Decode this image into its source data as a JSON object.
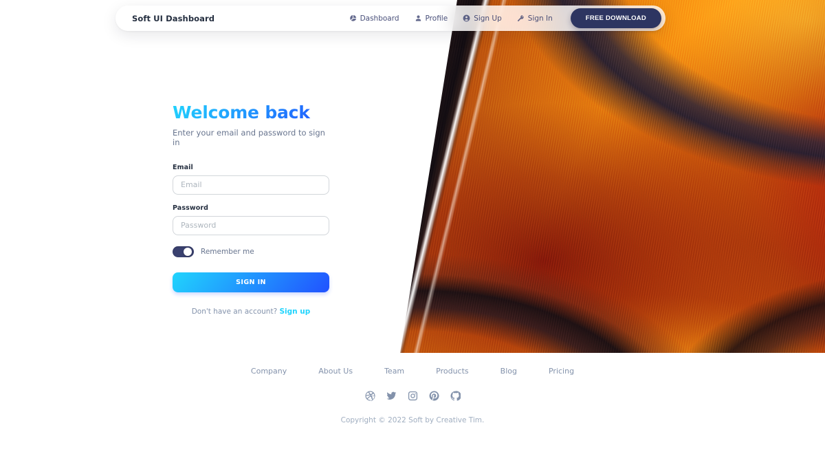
{
  "navbar": {
    "brand": "Soft UI Dashboard",
    "links": [
      {
        "label": "Dashboard",
        "icon": "chart-pie-icon"
      },
      {
        "label": "Profile",
        "icon": "person-icon"
      },
      {
        "label": "Sign Up",
        "icon": "user-circle-icon"
      },
      {
        "label": "Sign In",
        "icon": "key-icon"
      }
    ],
    "cta_label": "FREE DOWNLOAD",
    "cta_color": "#2d3561"
  },
  "form": {
    "heading": "Welcome back",
    "subtitle": "Enter your email and password to sign in",
    "email_label": "Email",
    "email_placeholder": "Email",
    "email_value": "",
    "password_label": "Password",
    "password_placeholder": "Password",
    "password_value": "",
    "remember_label": "Remember me",
    "remember_checked": "on",
    "submit_label": "SIGN IN",
    "signup_prompt": "Don't have an account?",
    "signup_link": "Sign up",
    "accent_start": "#21d4fd",
    "accent_end": "#2152ff"
  },
  "footer": {
    "links": [
      "Company",
      "About Us",
      "Team",
      "Products",
      "Blog",
      "Pricing"
    ],
    "social": [
      {
        "name": "dribbble-icon"
      },
      {
        "name": "twitter-icon"
      },
      {
        "name": "instagram-icon"
      },
      {
        "name": "pinterest-icon"
      },
      {
        "name": "github-icon"
      }
    ],
    "copyright": "Copyright © 2022 Soft by Creative Tim."
  },
  "hero": {
    "alt": "abstract swirling orange and red ribbon artwork"
  }
}
